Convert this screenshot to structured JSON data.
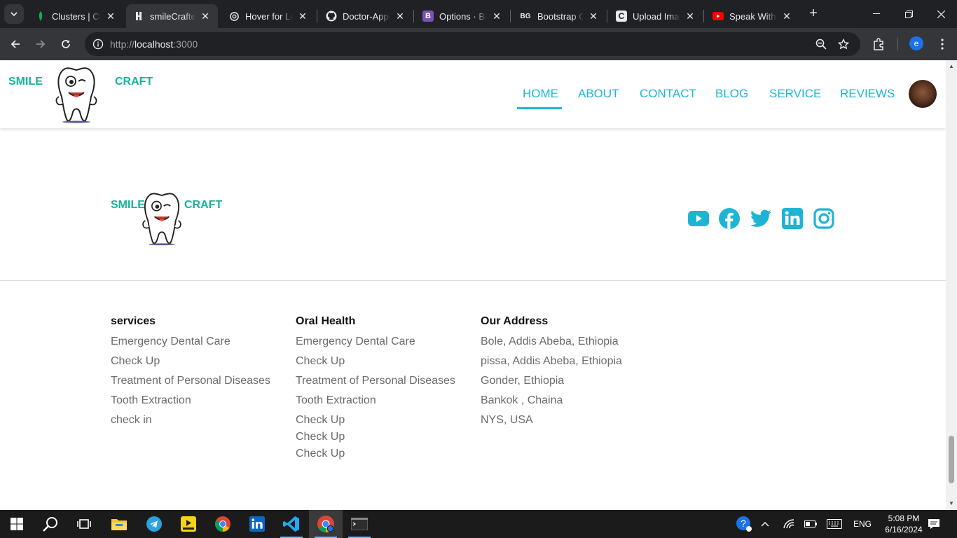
{
  "browser": {
    "tabs": [
      {
        "title": "Clusters | Cl",
        "icon": "leaf-icon"
      },
      {
        "title": "smileCrafted",
        "icon": "github-page-icon"
      },
      {
        "title": "Hover for Lo",
        "icon": "openai-icon"
      },
      {
        "title": "Doctor-Appo",
        "icon": "github-icon"
      },
      {
        "title": "Options · Bo",
        "icon": "bootstrap-icon"
      },
      {
        "title": "Bootstrap Ga",
        "icon": "bg-icon"
      },
      {
        "title": "Upload Imag",
        "icon": "c-icon"
      },
      {
        "title": "Speak With",
        "icon": "youtube-icon"
      }
    ],
    "active_tab": 1,
    "url_prefix": "http://",
    "url_host": "localhost",
    "url_port": ":3000",
    "profile_initial": "e"
  },
  "site": {
    "brand_left": "SMILE",
    "brand_right": "CRAFT",
    "nav": [
      "HOME",
      "ABOUT",
      "CONTACT",
      "BLOG",
      "SERVICE",
      "REVIEWS"
    ],
    "active_nav": "HOME",
    "colors": {
      "accent": "#1eb5d4",
      "brand": "#15b39a"
    }
  },
  "footer": {
    "brand_left": "SMILE",
    "brand_right": "CRAFT",
    "social": [
      "youtube-icon",
      "facebook-icon",
      "twitter-icon",
      "linkedin-icon",
      "instagram-icon"
    ],
    "columns": [
      {
        "heading": "services",
        "items": [
          "Emergency Dental Care",
          "Check Up",
          "Treatment of Personal Diseases",
          "Tooth Extraction",
          "check in"
        ]
      },
      {
        "heading": "Oral Health",
        "items": [
          "Emergency Dental Care",
          "Check Up",
          "Treatment of Personal Diseases",
          "Tooth Extraction",
          "Check Up",
          "Check Up",
          "Check Up"
        ]
      },
      {
        "heading": "Our Address",
        "items": [
          "Bole, Addis Abeba, Ethiopia",
          "pissa, Addis Abeba, Ethiopia",
          "Gonder, Ethiopia",
          "Bankok , Chaina",
          "NYS, USA"
        ]
      }
    ]
  },
  "taskbar": {
    "apps": [
      "start-icon",
      "search-icon",
      "task-view-icon",
      "file-explorer-icon",
      "telegram-icon",
      "video-player-icon",
      "chrome-icon",
      "linkedin-icon",
      "vscode-icon",
      "chrome-profile-icon",
      "terminal-icon"
    ],
    "language": "ENG",
    "time": "5:08 PM",
    "date": "6/16/2024"
  }
}
